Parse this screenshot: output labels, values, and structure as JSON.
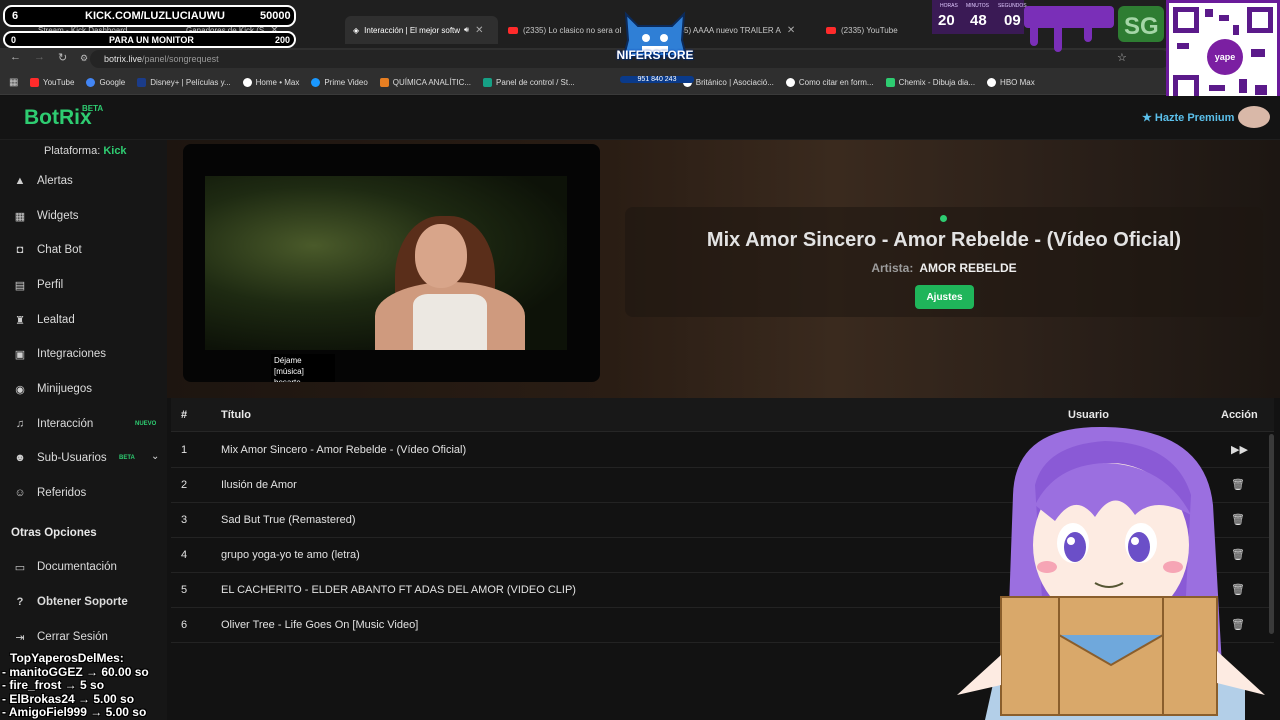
{
  "browser": {
    "tabs": [
      {
        "label": "Stream - Kick Dashboard"
      },
      {
        "label": "Ganadores de Kick (S"
      },
      {
        "label": "Interacción | El mejor softw",
        "active": true
      },
      {
        "label": "(2335) Lo clasico no sera ol"
      },
      {
        "label": "(2335) AAAA nuevo TRAILER A"
      },
      {
        "label": "(2335) YouTube"
      }
    ],
    "url_domain": "botrix.live",
    "url_path": "/panel/songrequest",
    "bookmarks": [
      {
        "label": "YouTube",
        "color": "#ff2b2b"
      },
      {
        "label": "Google",
        "color": "#4285f4"
      },
      {
        "label": "Disney+ | Películas y...",
        "color": "#1b3c8a"
      },
      {
        "label": "Home • Max",
        "color": "#ffffff"
      },
      {
        "label": "Prime Video",
        "color": "#1a98ff"
      },
      {
        "label": "QUÍMICA ANALÍTIC...",
        "color": "#e67e22"
      },
      {
        "label": "Panel de control / St...",
        "color": "#16a085"
      },
      {
        "label": "Británico | Asociació...",
        "color": "#ffffff"
      },
      {
        "label": "Como citar en form...",
        "color": "#ffffff"
      },
      {
        "label": "Chemix - Dibuja dia...",
        "color": "#2ecc71"
      },
      {
        "label": "HBO Max",
        "color": "#ffffff"
      }
    ]
  },
  "overlay": {
    "subs_count": "6",
    "channel": "KICK.COM/LUZLUCIAUWU",
    "subs_goal": "50000",
    "monitor_count": "0",
    "monitor_label": "PARA UN MONITOR",
    "monitor_goal": "200",
    "timer": {
      "labels": [
        "HORAS",
        "MINUTOS",
        "SEGUNDOS"
      ],
      "hours": "20",
      "minutes": "48",
      "seconds": "09"
    },
    "store_name": "NIFERSTORE",
    "store_sub": "951 840 243",
    "yape_label": "yape",
    "top_title": "TopYaperosDelMes:",
    "top_list": [
      "- manitoGGEZ → 60.00 so",
      "- fire_frost → 5 so",
      "- ElBrokas24 → 5.00 so",
      "- AmigoFiel999 → 5.00 so"
    ]
  },
  "app": {
    "brand": "BotRix",
    "brand_badge": "BETA",
    "premium": "Hazte Premium",
    "platform_label": "Plataforma:",
    "platform_value": "Kick",
    "nav": [
      {
        "label": "Alertas",
        "icon": "bell-icon"
      },
      {
        "label": "Widgets",
        "icon": "grid-icon"
      },
      {
        "label": "Chat Bot",
        "icon": "robot-icon"
      },
      {
        "label": "Perfil",
        "icon": "id-card-icon"
      },
      {
        "label": "Lealtad",
        "icon": "trophy-icon"
      },
      {
        "label": "Integraciones",
        "icon": "plug-icon"
      },
      {
        "label": "Minijuegos",
        "icon": "gamepad-icon"
      },
      {
        "label": "Interacción",
        "icon": "music-icon",
        "badge": "NUEVO"
      },
      {
        "label": "Sub-Usuarios",
        "icon": "users-icon",
        "badge": "BETA"
      },
      {
        "label": "Referidos",
        "icon": "user-group-icon"
      }
    ],
    "other_title": "Otras Opciones",
    "other": [
      {
        "label": "Documentación",
        "icon": "book-icon"
      },
      {
        "label": "Obtener Soporte",
        "icon": "question-icon"
      },
      {
        "label": "Cerrar Sesión",
        "icon": "logout-icon"
      }
    ],
    "subtitle_text": "Déjame [música] besarte.",
    "now_playing": {
      "title": "Mix Amor Sincero - Amor Rebelde - (Vídeo Oficial)",
      "artist_label": "Artista:",
      "artist": "AMOR REBELDE",
      "settings": "Ajustes"
    },
    "queue": {
      "headers": {
        "num": "#",
        "title": "Título",
        "user": "Usuario",
        "action": "Acción"
      },
      "rows": [
        {
          "num": "1",
          "title": "Mix Amor Sincero - Amor Rebelde - (Vídeo Oficial)",
          "action": "skip-icon"
        },
        {
          "num": "2",
          "title": "Ilusión de Amor",
          "action": "trash-icon"
        },
        {
          "num": "3",
          "title": "Sad But True (Remastered)",
          "action": "trash-icon"
        },
        {
          "num": "4",
          "title": "grupo yoga-yo te amo (letra)",
          "action": "trash-icon"
        },
        {
          "num": "5",
          "title": "EL CACHERITO - ELDER ABANTO FT ADAS DEL AMOR (VIDEO CLIP)",
          "action": "trash-icon"
        },
        {
          "num": "6",
          "title": "Oliver Tree - Life Goes On [Music Video]",
          "action": "trash-icon"
        }
      ]
    }
  },
  "colors": {
    "accent": "#2ecc71",
    "premium": "#5bc0eb",
    "button": "#1fb55a"
  }
}
